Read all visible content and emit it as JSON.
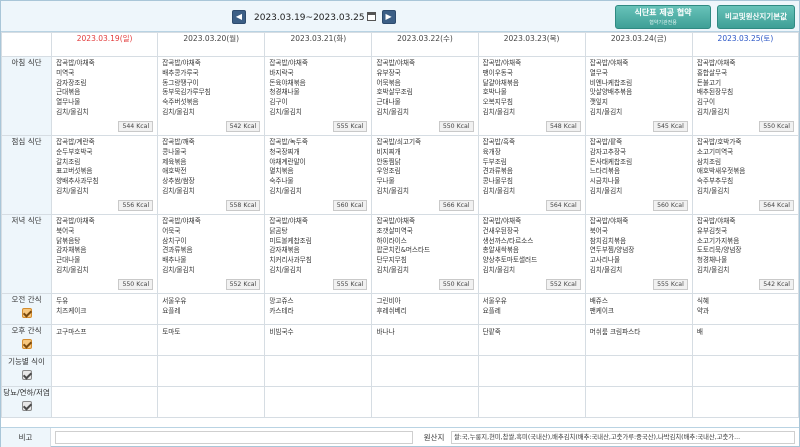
{
  "nav": {
    "date_range": "2023.03.19~2023.03.25",
    "prev_label": "◀",
    "next_label": "▶"
  },
  "buttons": {
    "provide_main": "식단표 제공 협약",
    "provide_sub": "협약기관전용",
    "standard": "비교및원산지기본값"
  },
  "days": [
    "2023.03.19(일)",
    "2023.03.20(월)",
    "2023.03.21(화)",
    "2023.03.22(수)",
    "2023.03.23(목)",
    "2023.03.24(금)",
    "2023.03.25(토)"
  ],
  "row_labels": {
    "breakfast": "아침 식단",
    "lunch": "점심 식단",
    "dinner": "저녁 식단",
    "am_snack": "오전 간식",
    "pm_snack": "오후 간식",
    "special": "기능별 식이",
    "diabetic": "당뇨/연하/저염"
  },
  "meals": {
    "breakfast": [
      {
        "items": [
          "잡곡밥/야채죽",
          "미역국",
          "감자장조림",
          "근대볶음",
          "열무나물",
          "김치/물김치"
        ],
        "kcal": "544 Kcal"
      },
      {
        "items": [
          "잡곡밥/야채죽",
          "배추콩가루국",
          "동그랑땡구이",
          "동부묵김가루무침",
          "숙주버섯볶음",
          "김치/물김치"
        ],
        "kcal": "542 Kcal"
      },
      {
        "items": [
          "잡곡밥/야채죽",
          "바지락국",
          "돈육야채볶음",
          "청경채나물",
          "김구이",
          "김치/물김치"
        ],
        "kcal": "555 Kcal"
      },
      {
        "items": [
          "잡곡밥/야채죽",
          "유부장국",
          "어묵볶음",
          "호박살무조림",
          "근대나물",
          "김치/물김치"
        ],
        "kcal": "550 Kcal"
      },
      {
        "items": [
          "잡곡밥/야채죽",
          "팽이우동국",
          "달걀야채볶음",
          "호박나물",
          "오복지무침",
          "김치/물김치"
        ],
        "kcal": "548 Kcal"
      },
      {
        "items": [
          "잡곡밥/야채죽",
          "열무국",
          "비엔나케찹조림",
          "맛살양배추볶음",
          "깻잎지",
          "김치/물김치"
        ],
        "kcal": "545 Kcal"
      },
      {
        "items": [
          "잡곡밥/야채죽",
          "홍합살무국",
          "돈불고기",
          "배추된장무침",
          "김구이",
          "김치/물김치"
        ],
        "kcal": "550 Kcal"
      }
    ],
    "lunch": [
      {
        "items": [
          "잡곡밥/계란죽",
          "순두부호박국",
          "갈치조림",
          "표고버섯볶음",
          "양배추사과무침",
          "김치/물김치"
        ],
        "kcal": "556 Kcal"
      },
      {
        "items": [
          "잡곡밥/깨죽",
          "콩나물국",
          "제육볶음",
          "애호박전",
          "상추쌈/쌈장",
          "김치/물김치"
        ],
        "kcal": "558 Kcal"
      },
      {
        "items": [
          "잡곡밥/녹두죽",
          "청국장찌개",
          "야채계란말이",
          "멸치볶음",
          "숙주나물",
          "김치/물김치"
        ],
        "kcal": "560 Kcal"
      },
      {
        "items": [
          "잡곡밥/쇠고기죽",
          "비지찌개",
          "안동찜닭",
          "우엉조림",
          "무나물",
          "김치/물김치"
        ],
        "kcal": "566 Kcal"
      },
      {
        "items": [
          "잡곡밥/흑죽",
          "육개장",
          "두부조림",
          "견과류볶음",
          "콩나물무침",
          "김치/물김치"
        ],
        "kcal": "564 Kcal"
      },
      {
        "items": [
          "잡곡밥/팥죽",
          "감자고추장국",
          "돈사태케찹조림",
          "느타리볶음",
          "시금치나물",
          "김치/물김치"
        ],
        "kcal": "560 Kcal"
      },
      {
        "items": [
          "잡곡밥/호박가죽",
          "소고기미역국",
          "삼치조림",
          "애호박새우젓볶음",
          "숙주부추무침",
          "김치/물김치"
        ],
        "kcal": "564 Kcal"
      }
    ],
    "dinner": [
      {
        "items": [
          "잡곡밥/야채죽",
          "북어국",
          "닭볶음탕",
          "감자채볶음",
          "근대나물",
          "김치/물김치"
        ],
        "kcal": "550 Kcal"
      },
      {
        "items": [
          "잡곡밥/야채죽",
          "어묵국",
          "삼치구이",
          "견과류볶음",
          "배추나물",
          "김치/물김치"
        ],
        "kcal": "552 Kcal"
      },
      {
        "items": [
          "잡곡밥/야채죽",
          "닭곰탕",
          "미트볼케찹조림",
          "감자채볶음",
          "치커리사과무침",
          "김치/물김치"
        ],
        "kcal": "555 Kcal"
      },
      {
        "items": [
          "잡곡밥/야채죽",
          "조갯살미역국",
          "하이라이스",
          "팝콘치킨&머스타드",
          "단무지무침",
          "김치/물김치"
        ],
        "kcal": "550 Kcal"
      },
      {
        "items": [
          "잡곡밥/야채죽",
          "건새우된장국",
          "생선까스/타르소스",
          "총알새싹볶음",
          "양상추토마토샐러드",
          "김치/물김치"
        ],
        "kcal": "552 Kcal"
      },
      {
        "items": [
          "잡곡밥/야채죽",
          "북어국",
          "참치김치볶음",
          "연두부찜/양념장",
          "고사리나물",
          "김치/물김치"
        ],
        "kcal": "555 Kcal"
      },
      {
        "items": [
          "잡곡밥/야채죽",
          "유부김칫국",
          "소고기가지볶음",
          "도토리묵/양념장",
          "청경채나물",
          "김치/물김치"
        ],
        "kcal": "542 Kcal"
      }
    ],
    "am_snack": [
      [
        "두유",
        "치즈케이크"
      ],
      [
        "서울우유",
        "요플레"
      ],
      [
        "망고쥬스",
        "카스테라"
      ],
      [
        "그린비아",
        "후레쉬베리"
      ],
      [
        "서울우유",
        "요플레"
      ],
      [
        "배쥬스",
        "팬케이크"
      ],
      [
        "식혜",
        "약과"
      ]
    ],
    "pm_snack": [
      [
        "고구마스프"
      ],
      [
        "토마토"
      ],
      [
        "비빔국수"
      ],
      [
        "바나나"
      ],
      [
        "단팥죽"
      ],
      [
        "머쉬룸 크림파스타"
      ],
      [
        "배"
      ]
    ]
  },
  "footer": {
    "note_label": "비고",
    "origin_label": "원산지",
    "origin_text": "쌀:국,누룽지,현미,찹쌀,흑미(국내산),배추김치(배추:국내산,고춧가루:중국산),나박김치(배추:국내산,고춧가..."
  }
}
